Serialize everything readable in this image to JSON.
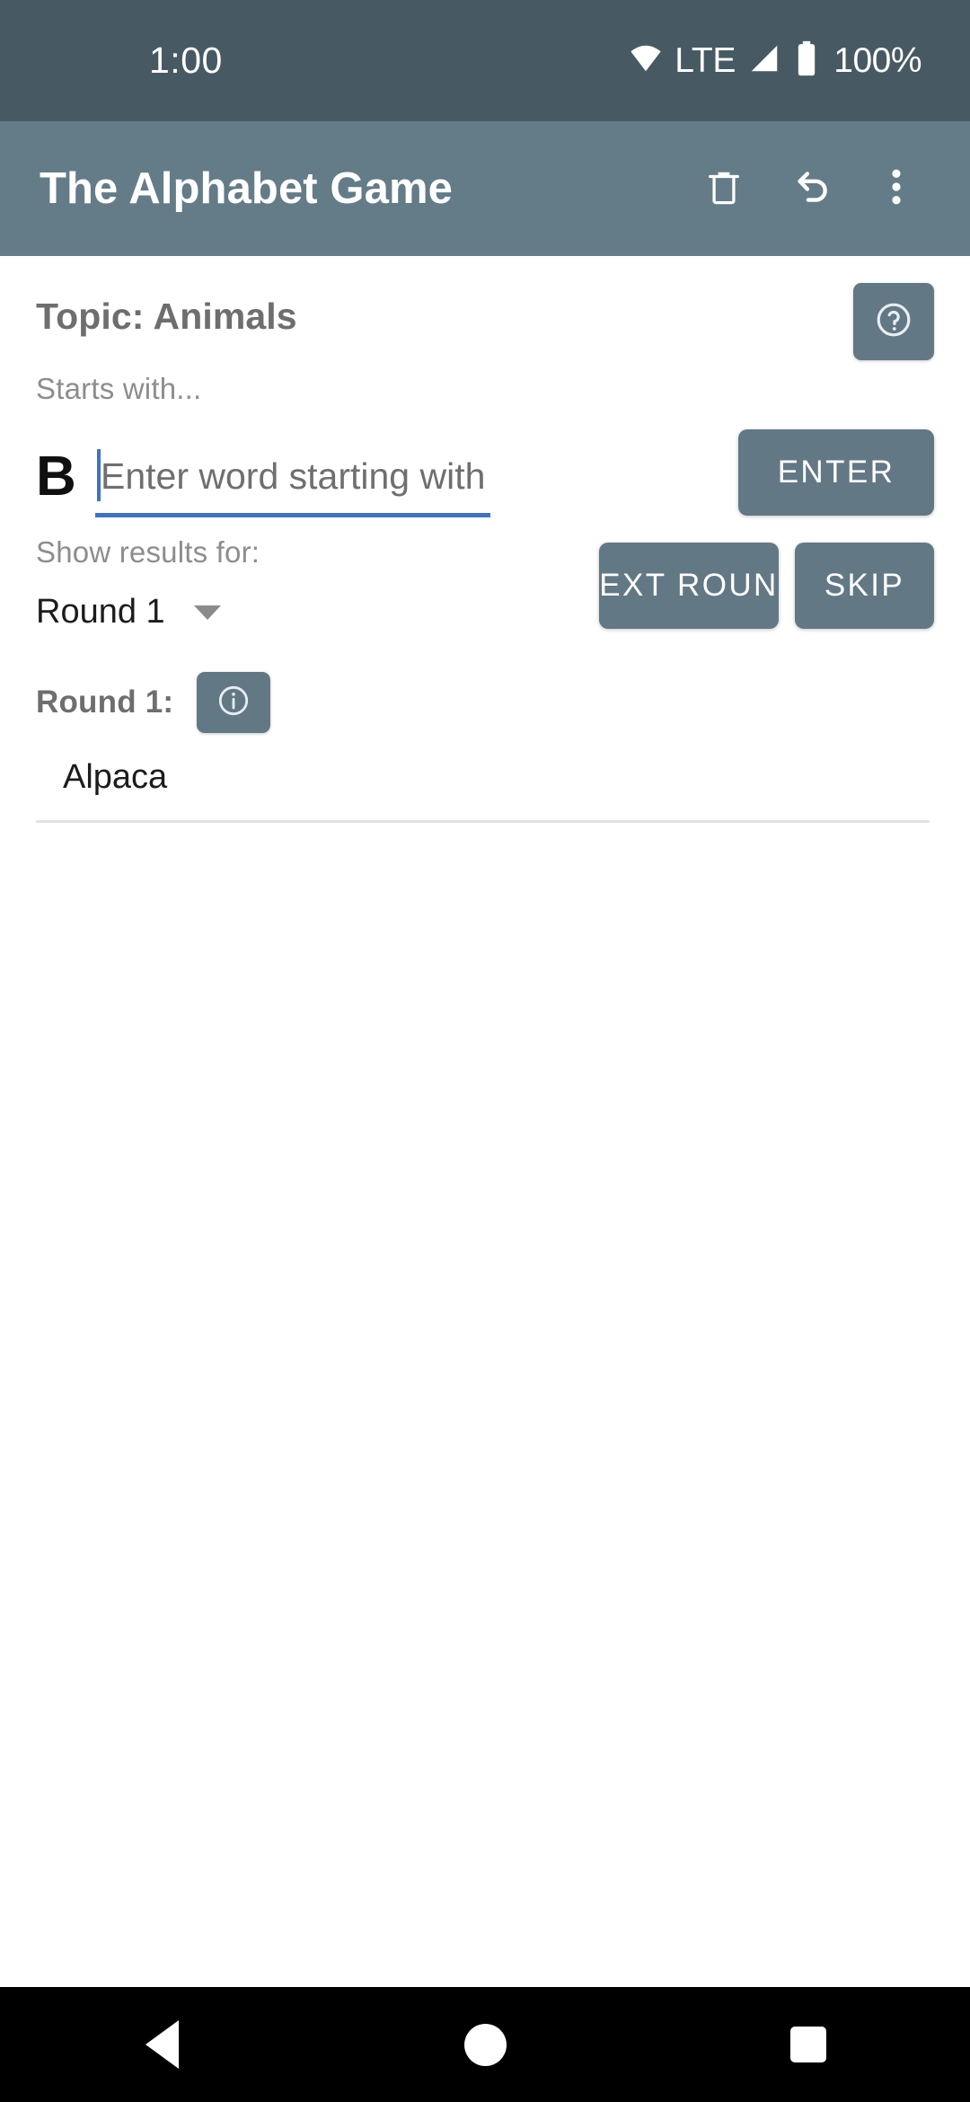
{
  "status_bar": {
    "time": "1:00",
    "network_label": "LTE",
    "battery_label": "100%",
    "icons": {
      "wifi": "wifi-icon",
      "signal": "cellular-signal-icon",
      "battery": "battery-icon"
    },
    "background_color": "#475a63"
  },
  "app_bar": {
    "title": "The Alphabet Game",
    "background_color": "#647c88",
    "actions": [
      {
        "name": "delete-button",
        "icon": "trash-icon"
      },
      {
        "name": "undo-button",
        "icon": "undo-icon"
      },
      {
        "name": "overflow-menu-button",
        "icon": "more-vertical-icon"
      }
    ]
  },
  "main": {
    "topic_label": "Topic: Animals",
    "help_button_icon": "help-circle-icon",
    "starts_with_label": "Starts with...",
    "current_letter": "B",
    "word_input": {
      "value": "",
      "placeholder": "Enter word starting with B"
    },
    "enter_button_label": "ENTER",
    "show_results_label": "Show results for:",
    "round_select": {
      "selected": "Round 1",
      "options": [
        "Round 1"
      ]
    },
    "next_round_button_label": "NEXT ROUND",
    "skip_button_label": "SKIP",
    "round_header_label": "Round 1:",
    "round_info_button_icon": "info-circle-icon",
    "words": [
      "Alpaca"
    ],
    "accent_color": "#637885",
    "focus_color": "#3f72c4"
  },
  "nav_bar": {
    "back": "back-triangle-icon",
    "home": "home-circle-icon",
    "recents": "recents-square-icon",
    "background_color": "#000000"
  }
}
